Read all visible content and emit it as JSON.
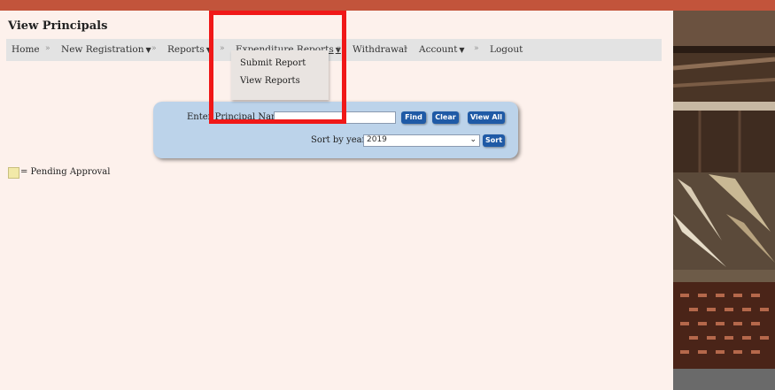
{
  "page": {
    "title": "View Principals"
  },
  "nav": {
    "items": [
      {
        "label": "Home"
      },
      {
        "label": "New Registration"
      },
      {
        "label": "Reports"
      },
      {
        "label": "Expenditure Reports"
      },
      {
        "label": "Withdrawal"
      },
      {
        "label": "Account"
      },
      {
        "label": "Logout"
      }
    ],
    "separator": "»"
  },
  "dropdown": {
    "items": [
      {
        "label": "Submit Report"
      },
      {
        "label": "View Reports"
      }
    ]
  },
  "search": {
    "name_label": "Enter Principal Name:",
    "name_value": "",
    "find_label": "Find",
    "clear_label": "Clear",
    "viewall_label": "View All",
    "sort_label": "Sort by year:",
    "year_value": "2019",
    "sort_button": "Sort"
  },
  "legend": {
    "text": "= Pending Approval",
    "pending_color": "#f2e9a8"
  },
  "colors": {
    "topbar": "#c2543b",
    "nav_bg": "#e3e3e3",
    "panel": "#bcd3ea",
    "button": "#1f5aa6",
    "highlight": "#f01818"
  }
}
